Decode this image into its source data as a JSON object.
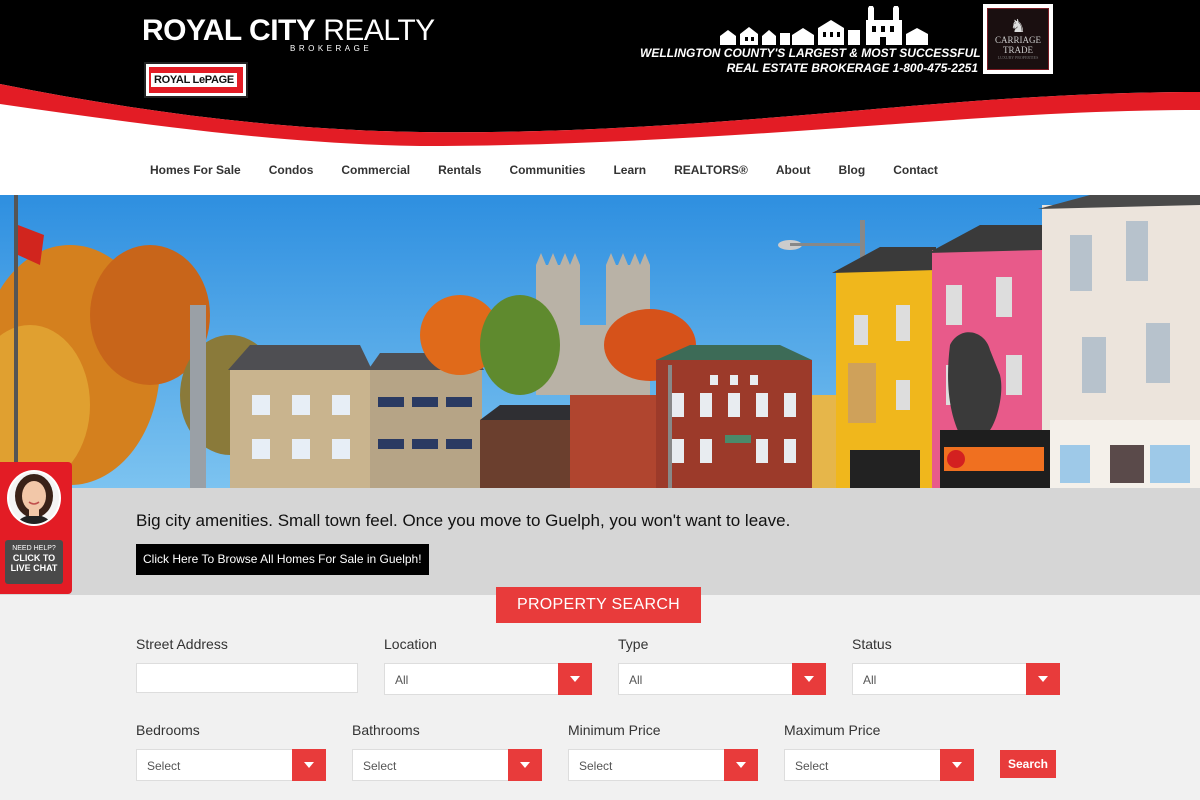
{
  "brand": {
    "name_bold": "ROYAL CITY",
    "name_light": " REALTY",
    "sub": "BROKERAGE",
    "partner_logo_text": "ROYAL LePAGE",
    "tagline_line1": "WELLINGTON COUNTY'S LARGEST & MOST SUCCESSFUL",
    "tagline_line2": "REAL ESTATE BROKERAGE 1-800-475-2251",
    "carriage_line1": "CARRIAGE",
    "carriage_line2": "TRADE",
    "carriage_line3": "LUXURY PROPERTIES"
  },
  "colors": {
    "accent": "#e83b3b",
    "header_bg": "#000000",
    "brand_red": "#e31c25",
    "banner_bg": "#d6d6d6"
  },
  "nav": {
    "items": [
      {
        "label": "Homes For Sale"
      },
      {
        "label": "Condos"
      },
      {
        "label": "Commercial"
      },
      {
        "label": "Rentals"
      },
      {
        "label": "Communities"
      },
      {
        "label": "Learn"
      },
      {
        "label": "REALTORS®"
      },
      {
        "label": "About"
      },
      {
        "label": "Blog"
      },
      {
        "label": "Contact"
      }
    ]
  },
  "banner": {
    "text": "Big city amenities. Small town feel. Once you move to Guelph, you won't want to leave.",
    "button": "Click Here To Browse All Homes For Sale in Guelph!"
  },
  "chat": {
    "line1": "NEED HELP?",
    "line2": "CLICK TO",
    "line3": "LIVE CHAT"
  },
  "search": {
    "title": "PROPERTY SEARCH",
    "street_label": "Street Address",
    "street_value": "",
    "location_label": "Location",
    "location_value": "All",
    "type_label": "Type",
    "type_value": "All",
    "status_label": "Status",
    "status_value": "All",
    "bedrooms_label": "Bedrooms",
    "bedrooms_value": "Select",
    "bathrooms_label": "Bathrooms",
    "bathrooms_value": "Select",
    "min_price_label": "Minimum Price",
    "min_price_value": "Select",
    "max_price_label": "Maximum Price",
    "max_price_value": "Select",
    "button": "Search"
  }
}
